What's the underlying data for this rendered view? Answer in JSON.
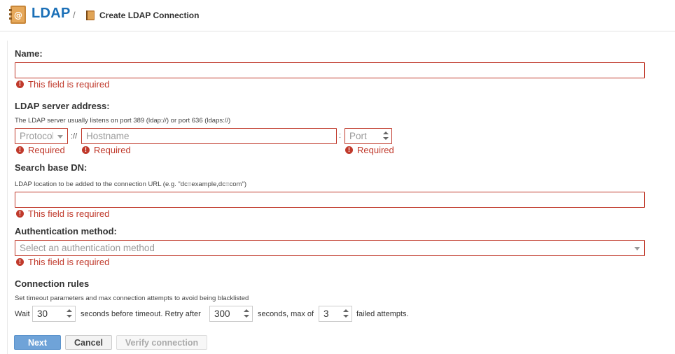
{
  "header": {
    "app_title": "LDAP",
    "separator": "/",
    "page_title": "Create LDAP Connection"
  },
  "form": {
    "name": {
      "label": "Name:",
      "value": "",
      "error": "This field is required"
    },
    "server": {
      "label": "LDAP server address:",
      "hint": "The LDAP server usually listens on port 389 (ldap://) or port 636 (ldaps://)",
      "protocol_placeholder": "Protocol",
      "scheme_separator": "://",
      "hostname_placeholder": "Hostname",
      "port_separator": ":",
      "port_placeholder": "Port",
      "protocol_error": "Required",
      "hostname_error": "Required",
      "port_error": "Required"
    },
    "base_dn": {
      "label": "Search base DN:",
      "hint": "LDAP location to be added to the connection URL (e.g. \"dc=example,dc=com\")",
      "value": "",
      "error": "This field is required"
    },
    "auth": {
      "label": "Authentication method:",
      "placeholder": "Select an authentication method",
      "error": "This field is required"
    },
    "rules": {
      "label": "Connection rules",
      "hint": "Set timeout parameters and max connection attempts to avoid being blacklisted",
      "wait_label": "Wait",
      "timeout_value": "30",
      "timeout_suffix": "seconds before timeout. Retry after",
      "retry_value": "300",
      "retry_suffix": "seconds, max of",
      "attempts_value": "3",
      "attempts_suffix": "failed attempts."
    }
  },
  "buttons": {
    "next": "Next",
    "cancel": "Cancel",
    "verify": "Verify connection"
  },
  "colors": {
    "brand": "#1a6fb7",
    "error": "#c0392b",
    "primary_button": "#6fa3d8"
  },
  "icons": {
    "app": "address-book-icon",
    "crumb": "book-icon",
    "error": "exclamation-circle-icon"
  }
}
